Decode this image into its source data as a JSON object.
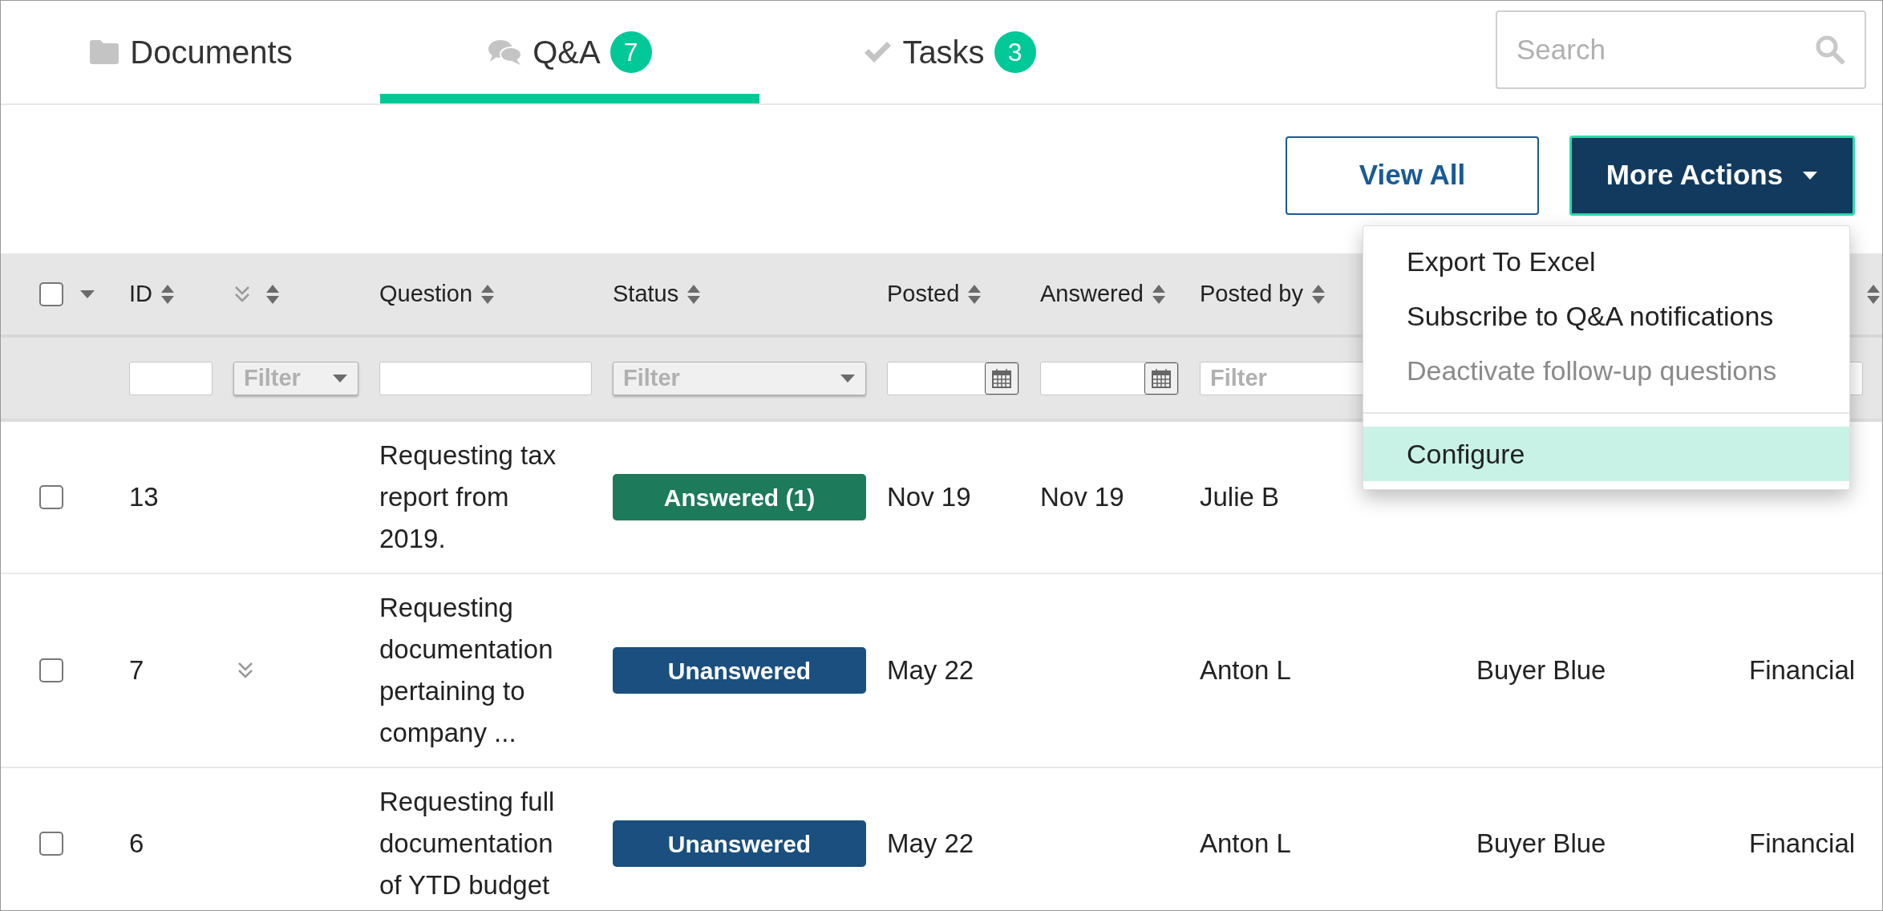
{
  "tabs": [
    {
      "label": "Documents",
      "kind": "documents",
      "selected": false
    },
    {
      "label": "Q&A",
      "kind": "questions",
      "badge": "7",
      "selected": true
    },
    {
      "label": "Tasks",
      "kind": "tasks",
      "badge": "3",
      "selected": false
    }
  ],
  "search": {
    "placeholder": "Search"
  },
  "actions": {
    "view_all": "View All",
    "more_actions": {
      "label": "More Actions",
      "expanded": true
    }
  },
  "menu": {
    "groups": [
      [
        {
          "label": "Export To Excel",
          "disabled": false,
          "selected": false
        },
        {
          "label": "Subscribe to Q&A notifications",
          "disabled": false,
          "selected": false
        },
        {
          "label": "Deactivate follow-up questions",
          "disabled": true,
          "selected": false
        }
      ],
      [
        {
          "label": "Configure",
          "disabled": false,
          "selected": true
        }
      ]
    ]
  },
  "table": {
    "columns": [
      {
        "kind": "select_all",
        "checked": false
      },
      {
        "kind": "sort",
        "label": "ID"
      },
      {
        "kind": "expand_sort"
      },
      {
        "kind": "sort",
        "label": "Question"
      },
      {
        "kind": "sort",
        "label": "Status"
      },
      {
        "kind": "sort",
        "label": "Posted"
      },
      {
        "kind": "sort",
        "label": "Answered"
      },
      {
        "kind": "sort",
        "label": "Posted by"
      },
      {
        "kind": "covered"
      },
      {
        "kind": "sort_only"
      }
    ],
    "filters": [
      {
        "kind": "none"
      },
      {
        "kind": "text"
      },
      {
        "kind": "select",
        "placeholder": "Filter"
      },
      {
        "kind": "text"
      },
      {
        "kind": "select",
        "placeholder": "Filter"
      },
      {
        "kind": "date"
      },
      {
        "kind": "date"
      },
      {
        "kind": "text",
        "placeholder": "Filter"
      },
      {
        "kind": "none"
      },
      {
        "kind": "text"
      }
    ],
    "rows": [
      {
        "checked": false,
        "id": "13",
        "followups": false,
        "question": "Requesting tax report from 2019.",
        "status": {
          "label": "Answered (1)",
          "kind": "answered"
        },
        "posted": "Nov 19",
        "answered": "Nov 19",
        "posted_by": "Julie B"
      },
      {
        "checked": false,
        "id": "7",
        "followups": true,
        "question": "Requesting documentation pertaining to company ...",
        "status": {
          "label": "Unanswered",
          "kind": "unanswered"
        },
        "posted": "May 22",
        "posted_by": "Anton L",
        "column_9": "Buyer Blue",
        "column_10": "Financial"
      },
      {
        "checked": false,
        "id": "6",
        "followups": false,
        "question": "Requesting full documentation of YTD budget",
        "status": {
          "label": "Unanswered",
          "kind": "unanswered"
        },
        "posted": "May 22",
        "posted_by": "Anton L",
        "column_9": "Buyer Blue",
        "column_10": "Financial"
      }
    ]
  }
}
